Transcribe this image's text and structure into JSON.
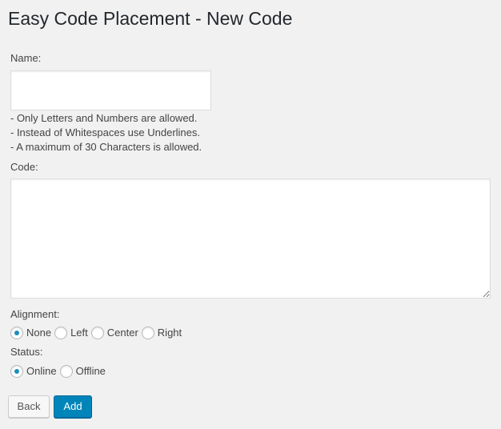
{
  "page": {
    "title": "Easy Code Placement - New Code"
  },
  "form": {
    "name_label": "Name:",
    "name_value": "",
    "hints": [
      "- Only Letters and Numbers are allowed.",
      "- Instead of Whitespaces use Underlines.",
      "- A maximum of 30 Characters is allowed."
    ],
    "code_label": "Code:",
    "code_value": "",
    "alignment_label": "Alignment:",
    "alignment_options": [
      "None",
      "Left",
      "Center",
      "Right"
    ],
    "alignment_selected": "None",
    "status_label": "Status:",
    "status_options": [
      "Online",
      "Offline"
    ],
    "status_selected": "Online"
  },
  "buttons": {
    "back_label": "Back",
    "add_label": "Add"
  },
  "colors": {
    "background": "#f1f1f1",
    "primary_button": "#0085ba",
    "radio_checked": "#1e8cbe"
  }
}
